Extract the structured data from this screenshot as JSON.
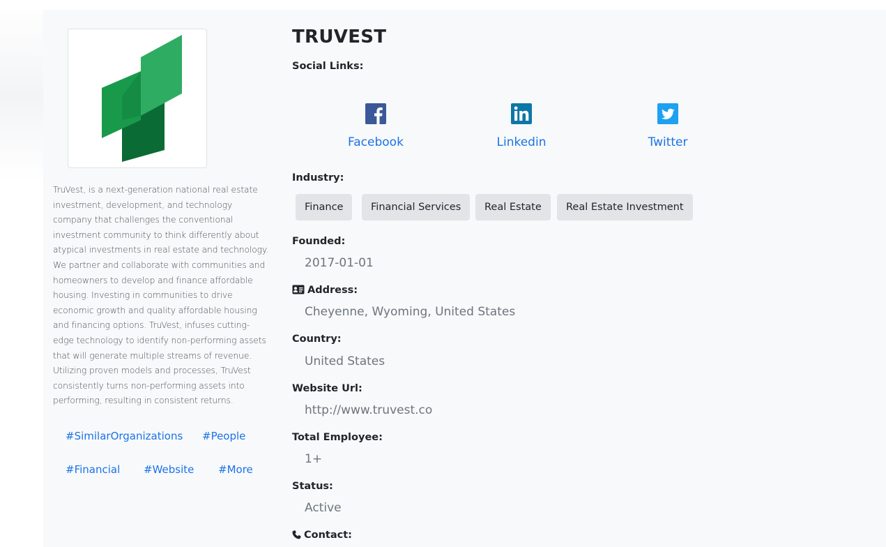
{
  "company": {
    "name": "TRUVEST",
    "description": "TruVest, is a next-generation national real estate investment, development, and technology company that challenges the conventional investment community to think differently about atypical investments in real estate and technology. We partner and collaborate with communities and homeowners to develop and finance affordable housing. Investing in communities to drive economic growth and quality affordable housing and financing options. TruVest, infuses cutting-edge technology to identify non-performing assets that will generate multiple streams of revenue. Utilizing proven models and processes, TruVest consistently turns non-performing assets into performing, resulting in consistent returns."
  },
  "tags": [
    "#SimilarOrganizations",
    "#People",
    "#Financial",
    "#Website",
    "#More"
  ],
  "social": {
    "label": "Social Links:",
    "links": [
      {
        "label": "Facebook",
        "icon": "facebook-icon",
        "color": "#3b5998"
      },
      {
        "label": "Linkedin",
        "icon": "linkedin-icon",
        "color": "#0e76a8"
      },
      {
        "label": "Twitter",
        "icon": "twitter-icon",
        "color": "#1da1f2"
      }
    ]
  },
  "industry": {
    "label": "Industry:",
    "items": [
      "Finance",
      "Financial Services",
      "Real Estate",
      "Real Estate Investment"
    ]
  },
  "founded": {
    "label": "Founded:",
    "value": "2017-01-01"
  },
  "address": {
    "label": "Address:",
    "icon": "address-card-icon",
    "value": "Cheyenne, Wyoming, United States"
  },
  "country": {
    "label": "Country:",
    "value": "United States"
  },
  "website": {
    "label": "Website Url:",
    "value": "http://www.truvest.co"
  },
  "employees": {
    "label": "Total Employee:",
    "value": "1+"
  },
  "status": {
    "label": "Status:",
    "value": "Active"
  },
  "contact": {
    "label": "Contact:",
    "icon": "phone-icon"
  },
  "colors": {
    "link": "#1a73e8",
    "muted": "#6c757d",
    "badge_bg": "#e2e4e8",
    "logo_green": "#1e9e55"
  }
}
